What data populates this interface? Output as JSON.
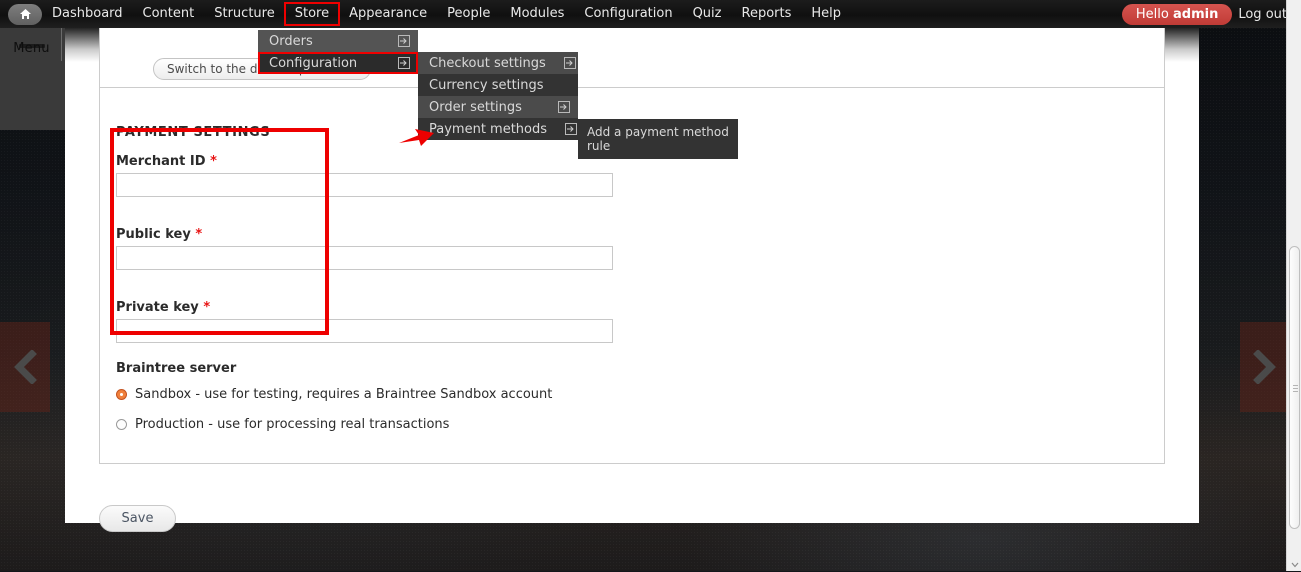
{
  "toolbar": {
    "home_icon": "home-icon",
    "items": [
      {
        "label": "Dashboard",
        "highlighted": false
      },
      {
        "label": "Content",
        "highlighted": false
      },
      {
        "label": "Structure",
        "highlighted": false
      },
      {
        "label": "Store",
        "highlighted": true
      },
      {
        "label": "Appearance",
        "highlighted": false
      },
      {
        "label": "People",
        "highlighted": false
      },
      {
        "label": "Modules",
        "highlighted": false
      },
      {
        "label": "Configuration",
        "highlighted": false
      },
      {
        "label": "Quiz",
        "highlighted": false
      },
      {
        "label": "Reports",
        "highlighted": false
      },
      {
        "label": "Help",
        "highlighted": false
      }
    ],
    "hello_prefix": "Hello ",
    "hello_user": "admin",
    "logout_label": "Log out",
    "highlight_color": "#ee0000",
    "badge_color": "#c03b36"
  },
  "rail": {
    "menu_label": "Menu",
    "hamburger_icon": "hamburger-icon"
  },
  "store_menu": {
    "items": [
      {
        "label": "Orders",
        "has_submenu": true,
        "state": "light"
      },
      {
        "label": "Configuration",
        "has_submenu": true,
        "state": "dark",
        "highlighted": true
      }
    ]
  },
  "configuration_menu": {
    "items": [
      {
        "label": "Checkout settings",
        "has_submenu": true,
        "state": "medium"
      },
      {
        "label": "Currency settings",
        "has_submenu": false,
        "state": "dark"
      },
      {
        "label": "Order settings",
        "has_submenu": true,
        "state": "medium"
      },
      {
        "label": "Payment methods",
        "has_submenu": true,
        "state": "dark"
      }
    ]
  },
  "tooltip": {
    "text": "Add a payment method rule"
  },
  "top_panel": {
    "switch_input_label": "Switch to the direct input mode"
  },
  "settings": {
    "title": "PAYMENT SETTINGS",
    "fields": [
      {
        "label": "Merchant ID",
        "required": true,
        "value": "",
        "placeholder": ""
      },
      {
        "label": "Public key",
        "required": true,
        "value": "",
        "placeholder": ""
      },
      {
        "label": "Private key",
        "required": true,
        "value": "",
        "placeholder": ""
      }
    ],
    "required_marker": "*",
    "server_group_label": "Braintree server",
    "server_options": [
      {
        "label": "Sandbox - use for testing, requires a Braintree Sandbox account",
        "selected": true
      },
      {
        "label": "Production - use for processing real transactions",
        "selected": false
      }
    ],
    "save_label": "Save",
    "highlight_color": "#ee0000",
    "radio_accent": "#f0803c"
  },
  "carousel": {
    "prev_icon": "chevron-left-icon",
    "next_icon": "chevron-right-icon"
  },
  "scrollbar": {
    "down_arrow_icon": "chevron-down-icon"
  }
}
